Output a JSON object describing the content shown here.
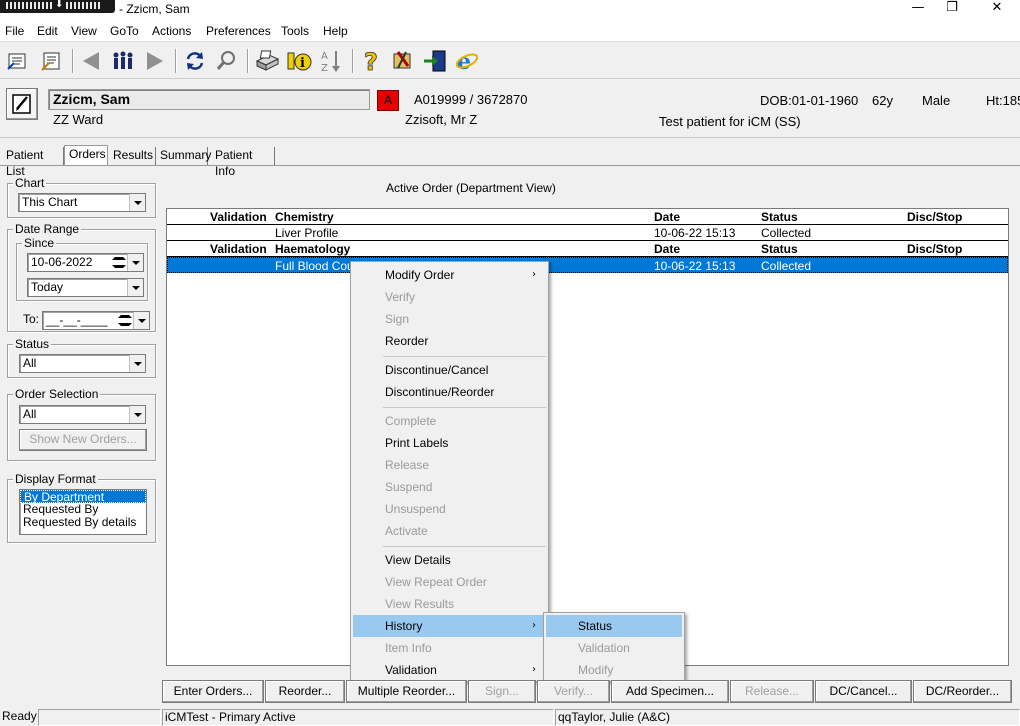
{
  "window": {
    "title": "- Zzicm, Sam",
    "minimize": "—",
    "restore": "❐",
    "close": "✕"
  },
  "menu": [
    "File",
    "Edit",
    "View",
    "GoTo",
    "Actions",
    "Preferences",
    "Tools",
    "Help"
  ],
  "toolbar": {
    "icons": [
      "patient-list-icon",
      "patient-chart-icon",
      "back-arrow-icon",
      "people-icon",
      "forward-arrow-icon",
      "refresh-icon",
      "search-icon",
      "print-icon",
      "info-icon",
      "sort-az-icon",
      "help-icon",
      "settings-icon",
      "exit-icon",
      "browser-icon"
    ]
  },
  "patient": {
    "name": "Zzicm, Sam",
    "ward": "ZZ Ward",
    "alert": "A",
    "id": "A019999 / 3672870",
    "doctor": "Zzisoft, Mr Z",
    "dob": "DOB:01-01-1960",
    "age": "62y",
    "sex": "Male",
    "height": "Ht:185",
    "note": "Test patient for iCM (SS)"
  },
  "tabs": [
    "Patient List",
    "Orders",
    "Results",
    "Summary",
    "Patient Info"
  ],
  "active_tab": "Orders",
  "filters": {
    "chart_label": "Chart",
    "chart_value": "This Chart",
    "date_range_label": "Date Range",
    "since_label": "Since",
    "since_date": "10-06-2022",
    "since_preset": "Today",
    "to_label": "To:",
    "to_date": "__-__-____",
    "status_label": "Status",
    "status_value": "All",
    "order_selection_label": "Order Selection",
    "order_selection_value": "All",
    "show_new_orders": "Show New Orders...",
    "display_format_label": "Display Format",
    "display_format_options": [
      "By Department",
      "Requested By",
      "Requested By details"
    ],
    "display_format_selected": "By Department"
  },
  "grid": {
    "title": "Active Order (Department View)",
    "sections": [
      {
        "header": {
          "validation": "Validation",
          "department": "Chemistry",
          "date": "Date",
          "status": "Status",
          "disc": "Disc/Stop"
        },
        "rows": [
          {
            "name": "Liver Profile",
            "date": "10-06-22 15:13",
            "status": "Collected",
            "selected": false
          }
        ]
      },
      {
        "header": {
          "validation": "Validation",
          "department": "Haematology",
          "date": "Date",
          "status": "Status",
          "disc": "Disc/Stop"
        },
        "rows": [
          {
            "name": "Full Blood Count",
            "date": "10-06-22 15:13",
            "status": "Collected",
            "selected": true
          }
        ]
      }
    ]
  },
  "context_menu": {
    "items": [
      {
        "label": "Modify Order",
        "enabled": true,
        "submenu": true
      },
      {
        "label": "Verify",
        "enabled": false
      },
      {
        "label": "Sign",
        "enabled": false
      },
      {
        "label": "Reorder",
        "enabled": true
      },
      {
        "separator": true
      },
      {
        "label": "Discontinue/Cancel",
        "enabled": true
      },
      {
        "label": "Discontinue/Reorder",
        "enabled": true
      },
      {
        "separator": true
      },
      {
        "label": "Complete",
        "enabled": false
      },
      {
        "label": "Print Labels",
        "enabled": true
      },
      {
        "label": "Release",
        "enabled": false
      },
      {
        "label": "Suspend",
        "enabled": false
      },
      {
        "label": "Unsuspend",
        "enabled": false
      },
      {
        "label": "Activate",
        "enabled": false
      },
      {
        "separator": true
      },
      {
        "label": "View Details",
        "enabled": true
      },
      {
        "label": "View Repeat Order",
        "enabled": false
      },
      {
        "label": "View Results",
        "enabled": false
      },
      {
        "label": "History",
        "enabled": true,
        "submenu": true,
        "highlighted": true
      },
      {
        "label": "Item Info",
        "enabled": false
      },
      {
        "label": "Validation",
        "enabled": true,
        "submenu": true
      }
    ],
    "history_submenu": [
      {
        "label": "Status",
        "enabled": true,
        "highlighted": true
      },
      {
        "label": "Validation",
        "enabled": false
      },
      {
        "label": "Modify",
        "enabled": false
      }
    ]
  },
  "bottom_buttons": [
    {
      "label": "Enter Orders...",
      "enabled": true
    },
    {
      "label": "Reorder...",
      "enabled": true
    },
    {
      "label": "Multiple Reorder...",
      "enabled": true
    },
    {
      "label": "Sign...",
      "enabled": false
    },
    {
      "label": "Verify...",
      "enabled": false
    },
    {
      "label": "Add Specimen...",
      "enabled": true
    },
    {
      "label": "Release...",
      "enabled": false
    },
    {
      "label": "DC/Cancel...",
      "enabled": true
    },
    {
      "label": "DC/Reorder...",
      "enabled": true
    }
  ],
  "statusbar": {
    "ready": "Ready",
    "environment": "iCMTest - Primary Active",
    "user": "qqTaylor, Julie  (A&C)"
  }
}
